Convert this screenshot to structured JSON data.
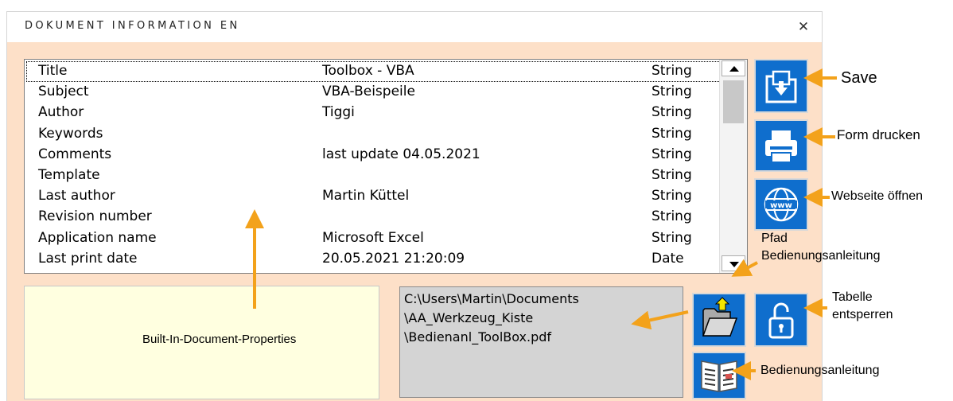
{
  "dialog": {
    "title": "DOKUMENT INFORMATION EN",
    "close_label": "✕"
  },
  "properties": {
    "rows": [
      {
        "name": "Title",
        "value": "Toolbox - VBA",
        "type": "String"
      },
      {
        "name": "Subject",
        "value": "VBA-Beispeile",
        "type": "String"
      },
      {
        "name": "Author",
        "value": "Tiggi",
        "type": "String"
      },
      {
        "name": "Keywords",
        "value": "",
        "type": "String"
      },
      {
        "name": "Comments",
        "value": "last update 04.05.2021",
        "type": "String"
      },
      {
        "name": "Template",
        "value": "",
        "type": "String"
      },
      {
        "name": "Last author",
        "value": "Martin Küttel",
        "type": "String"
      },
      {
        "name": "Revision number",
        "value": "",
        "type": "String"
      },
      {
        "name": "Application name",
        "value": "Microsoft Excel",
        "type": "String"
      },
      {
        "name": "Last print date",
        "value": "20.05.2021 21:20:09",
        "type": "Date"
      }
    ]
  },
  "property_panel": {
    "label": "Built-In-Document-Properties"
  },
  "path_box": {
    "lines": [
      "C:\\Users\\Martin\\Documents",
      "\\AA_Werkzeug_Kiste",
      "\\Bedienanl_ToolBox.pdf"
    ]
  },
  "annotations": {
    "save": "Save",
    "print": "Form drucken",
    "website": "Webseite öffnen",
    "path_line1": "Pfad",
    "path_line2": "Bedienungsanleitung",
    "unlock_line1": "Tabelle",
    "unlock_line2": "entsperren",
    "manual": "Bedienungsanleitung"
  },
  "icons": {
    "save": "save-icon",
    "print": "printer-icon",
    "website": "globe-www-icon",
    "open_folder": "folder-open-icon",
    "unlock": "unlock-icon",
    "manual": "book-icon",
    "annotation_arrow": "arrow-icon"
  },
  "colors": {
    "dialog_background": "#fde0c8",
    "button_blue": "#0f6ecd",
    "arrow_orange": "#f3a21b",
    "property_panel_bg": "#ffffe0",
    "path_box_bg": "#d4d4d4"
  }
}
